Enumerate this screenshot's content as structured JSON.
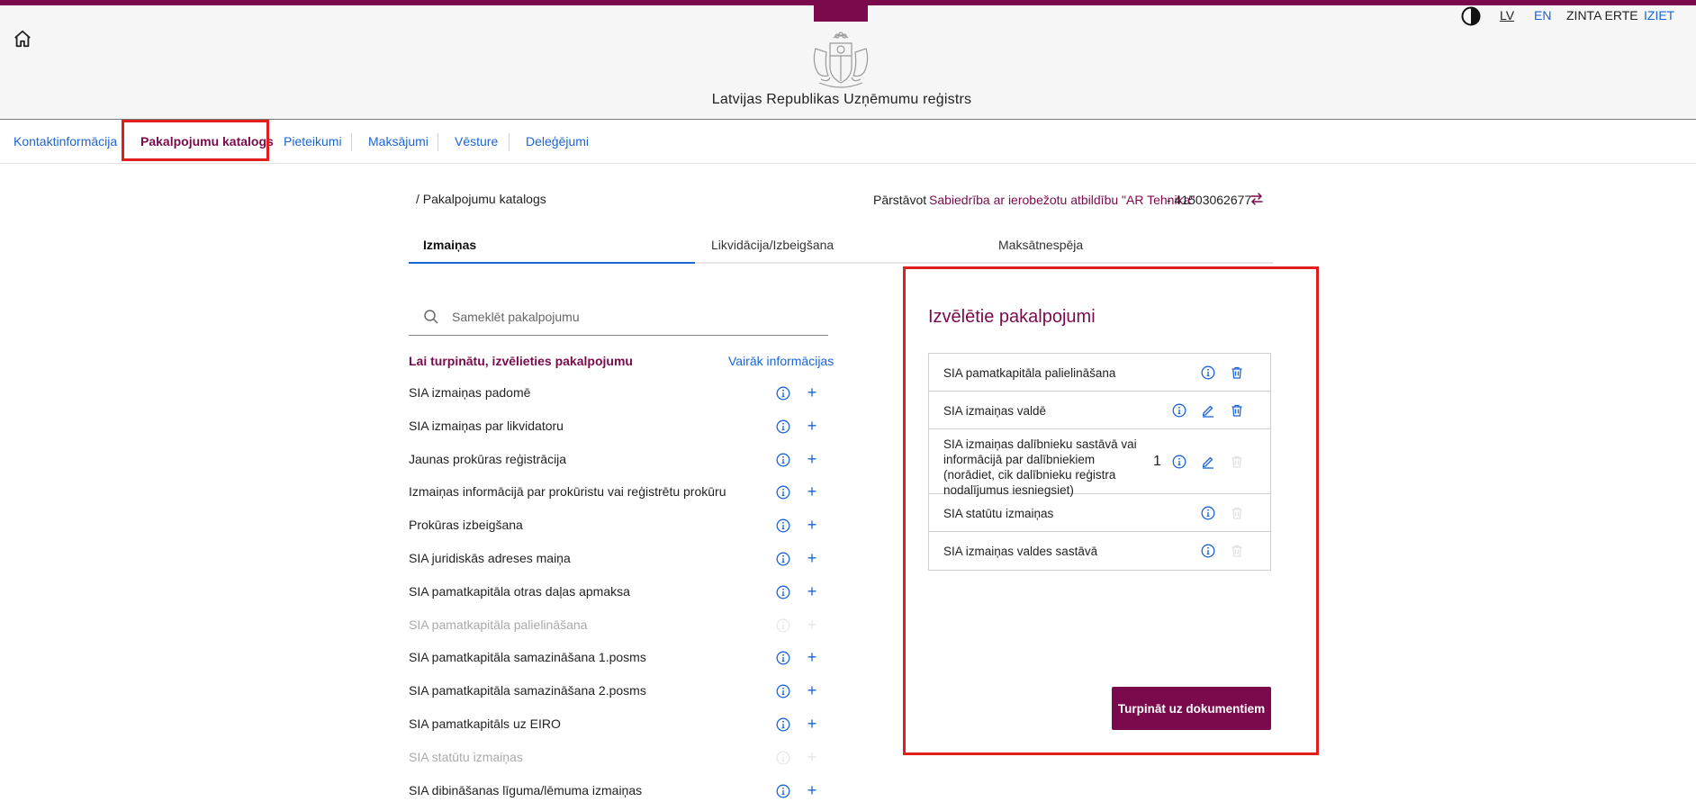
{
  "header": {
    "title": "Latvijas Republikas Uzņēmumu reģistrs",
    "lang_lv": "LV",
    "lang_en": "EN",
    "user": "ZINTA ERTE",
    "logout": "IZIET"
  },
  "nav": {
    "items": [
      {
        "label": "Kontaktinformācija"
      },
      {
        "label": "Pakalpojumu katalogs"
      },
      {
        "label": "Pieteikumi"
      },
      {
        "label": "Maksājumi"
      },
      {
        "label": "Vēsture"
      },
      {
        "label": "Deleģējumi"
      }
    ]
  },
  "breadcrumb": "/  Pakalpojumu katalogs",
  "representing": {
    "label": "Pārstāvot",
    "company": "Sabiedrība ar ierobežotu atbildību \"AR Tehnika\"",
    "code": "- 41503062677"
  },
  "tabs": [
    {
      "label": "Izmaiņas"
    },
    {
      "label": "Likvidācija/Izbeigšana"
    },
    {
      "label": "Maksātnespēja"
    }
  ],
  "search": {
    "placeholder": "Sameklēt pakalpojumu",
    "value": ""
  },
  "list": {
    "heading": "Lai turpinātu, izvēlieties pakalpojumu",
    "more_info": "Vairāk informācijas",
    "items": [
      {
        "label": "SIA izmaiņas padomē",
        "disabled": false
      },
      {
        "label": "SIA izmaiņas par likvidatoru",
        "disabled": false
      },
      {
        "label": "Jaunas prokūras reģistrācija",
        "disabled": false
      },
      {
        "label": "Izmaiņas informācijā par prokūristu vai reģistrētu prokūru",
        "disabled": false
      },
      {
        "label": "Prokūras izbeigšana",
        "disabled": false
      },
      {
        "label": "SIA juridiskās adreses maiņa",
        "disabled": false
      },
      {
        "label": "SIA pamatkapitāla otras daļas apmaksa",
        "disabled": false
      },
      {
        "label": "SIA pamatkapitāla palielināšana",
        "disabled": true
      },
      {
        "label": "SIA pamatkapitāla samazināšana 1.posms",
        "disabled": false
      },
      {
        "label": "SIA pamatkapitāla samazināšana 2.posms",
        "disabled": false
      },
      {
        "label": "SIA pamatkapitāls uz EIRO",
        "disabled": false
      },
      {
        "label": "SIA statūtu izmaiņas",
        "disabled": true
      },
      {
        "label": "SIA dibināšanas līguma/lēmuma izmaiņas",
        "disabled": false
      }
    ]
  },
  "selected": {
    "title": "Izvēlētie pakalpojumi",
    "items": [
      {
        "label": "SIA pamatkapitāla palielināšana",
        "count": "",
        "edit": false,
        "delete_enabled": true
      },
      {
        "label": "SIA izmaiņas valdē",
        "count": "",
        "edit": true,
        "delete_enabled": true
      },
      {
        "label": "SIA izmaiņas dalībnieku sastāvā vai informācijā par dalībniekiem (norādiet, cik dalībnieku reģistra nodalījumus iesniegsiet)",
        "count": "1",
        "edit": true,
        "delete_enabled": false
      },
      {
        "label": "SIA statūtu izmaiņas",
        "count": "",
        "edit": false,
        "delete_enabled": false
      },
      {
        "label": "SIA izmaiņas valdes sastāvā",
        "count": "",
        "edit": false,
        "delete_enabled": false
      }
    ],
    "cta": "Turpināt uz dokumentiem"
  },
  "colors": {
    "brand": "#7a0a4c",
    "link": "#1a64d6",
    "highlight": "#e01e1e"
  },
  "icons": [
    "home-icon",
    "coat-of-arms-logo",
    "contrast-icon",
    "swap-icon",
    "search-icon",
    "info-icon",
    "plus-icon",
    "edit-icon",
    "trash-icon"
  ]
}
